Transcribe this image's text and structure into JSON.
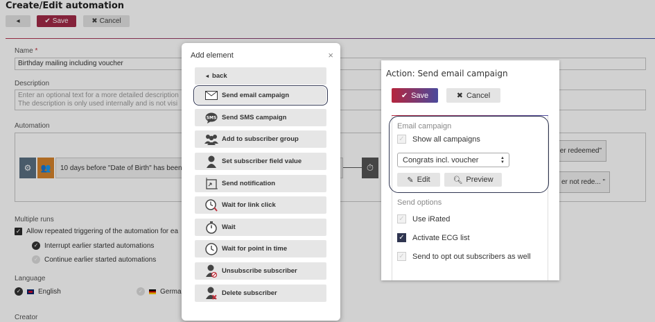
{
  "page": {
    "title": "Create/Edit automation",
    "save_label": "Save",
    "cancel_label": "Cancel",
    "name_label": "Name",
    "name_required": "*",
    "name_value": "Birthday mailing including voucher",
    "description_label": "Description",
    "description_placeholder_1": "Enter an optional text for a more detailed description",
    "description_placeholder_2": "The description is only used internally and is not visi",
    "automation_label": "Automation",
    "trigger_text": "10 days before \"Date of Birth\" has been",
    "right_box_1": "er redeemed\"",
    "right_box_2": "er not rede... \"",
    "multiple_runs_label": "Multiple runs",
    "allow_repeat": "Allow repeated triggering of the automation for ea",
    "interrupt": "Interrupt earlier started automations",
    "continue": "Continue earlier started automations",
    "language_label": "Language",
    "lang_english": "English",
    "lang_german": "Germa",
    "creator_label": "Creator"
  },
  "add_element": {
    "title": "Add element",
    "back_label": "back",
    "items": [
      {
        "label": "Send email campaign",
        "icon": "envelope-icon"
      },
      {
        "label": "Send SMS campaign",
        "icon": "sms-icon"
      },
      {
        "label": "Add to subscriber group",
        "icon": "group-icon"
      },
      {
        "label": "Set subscriber field value",
        "icon": "person-icon"
      },
      {
        "label": "Send notification",
        "icon": "notification-icon"
      },
      {
        "label": "Wait for link click",
        "icon": "clock-click-icon"
      },
      {
        "label": "Wait",
        "icon": "stopwatch-icon"
      },
      {
        "label": "Wait for point in time",
        "icon": "clock-icon"
      },
      {
        "label": "Unsubscribe subscriber",
        "icon": "person-unsubscribe-icon"
      },
      {
        "label": "Delete subscriber",
        "icon": "person-delete-icon"
      }
    ]
  },
  "action_panel": {
    "title": "Action: Send email campaign",
    "save_label": "Save",
    "cancel_label": "Cancel",
    "email_section_label": "Email campaign",
    "show_all_label": "Show all campaigns",
    "selected_campaign": "Congrats incl. voucher",
    "edit_label": "Edit",
    "preview_label": "Preview",
    "send_options_label": "Send options",
    "use_irated_label": "Use iRated",
    "activate_ecg_label": "Activate ECG list",
    "opt_out_label": "Send to opt out subscribers as well"
  }
}
